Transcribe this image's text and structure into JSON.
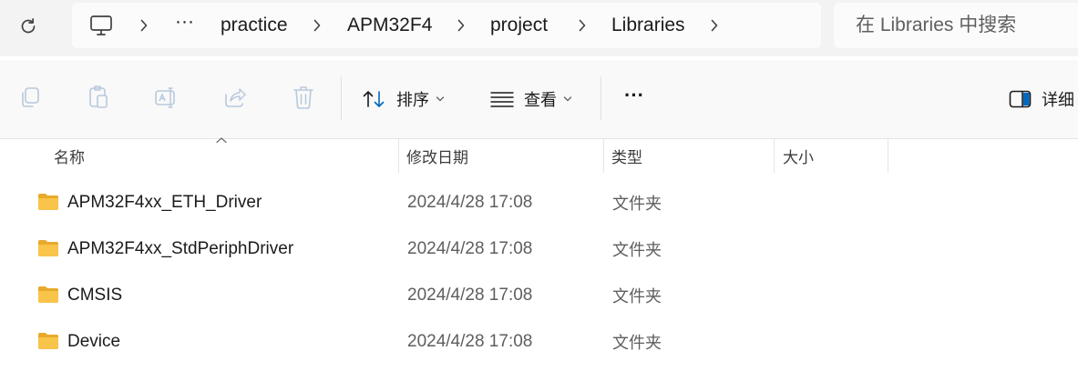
{
  "search": {
    "placeholder": "在 Libraries 中搜索"
  },
  "breadcrumb": {
    "more": "···",
    "items": [
      "practice",
      "APM32F4",
      "project",
      "Libraries"
    ]
  },
  "toolbar": {
    "sort_label": "排序",
    "view_label": "查看",
    "more_label": "···",
    "details_label": "详细"
  },
  "columns": {
    "name": "名称",
    "modified": "修改日期",
    "type": "类型",
    "size": "大小"
  },
  "files": [
    {
      "name": "APM32F4xx_ETH_Driver",
      "modified": "2024/4/28 17:08",
      "type": "文件夹"
    },
    {
      "name": "APM32F4xx_StdPeriphDriver",
      "modified": "2024/4/28 17:08",
      "type": "文件夹"
    },
    {
      "name": "CMSIS",
      "modified": "2024/4/28 17:08",
      "type": "文件夹"
    },
    {
      "name": "Device",
      "modified": "2024/4/28 17:08",
      "type": "文件夹"
    }
  ],
  "colors": {
    "folder": "#f8c44a",
    "folder_dark": "#e9a92a",
    "accent": "#0067c0"
  }
}
